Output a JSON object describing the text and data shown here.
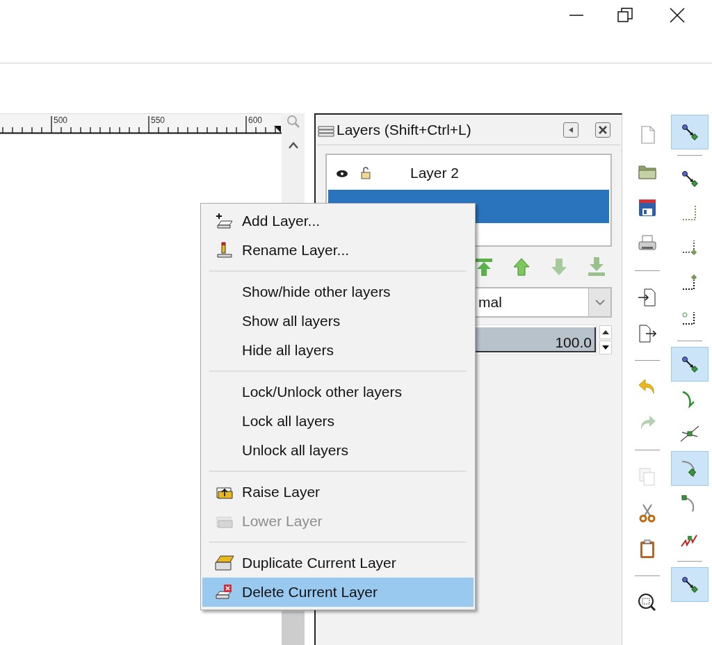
{
  "ruler": {
    "labels": [
      "500",
      "550",
      "600"
    ]
  },
  "layers_panel": {
    "title": "Layers (Shift+Ctrl+L)",
    "layers": [
      {
        "name": "Layer 2",
        "selected": false
      },
      {
        "selected": true
      }
    ],
    "blend_mode": {
      "value": "mal"
    },
    "opacity": {
      "value": "100.0",
      "level": 1
    }
  },
  "context_menu": [
    {
      "kind": "item",
      "label": "Add Layer...",
      "disabled": false,
      "selected": false
    },
    {
      "kind": "item",
      "label": "Rename Layer...",
      "disabled": false,
      "selected": false
    },
    {
      "kind": "separator"
    },
    {
      "kind": "item",
      "label": "Show/hide other layers",
      "disabled": false,
      "selected": false
    },
    {
      "kind": "item",
      "label": "Show all layers",
      "disabled": false,
      "selected": false
    },
    {
      "kind": "item",
      "label": "Hide all layers",
      "disabled": false,
      "selected": false
    },
    {
      "kind": "separator"
    },
    {
      "kind": "item",
      "label": "Lock/Unlock other layers",
      "disabled": false,
      "selected": false
    },
    {
      "kind": "item",
      "label": "Lock all layers",
      "disabled": false,
      "selected": false
    },
    {
      "kind": "item",
      "label": "Unlock all layers",
      "disabled": false,
      "selected": false
    },
    {
      "kind": "separator"
    },
    {
      "kind": "item",
      "label": "Raise Layer",
      "disabled": false,
      "selected": false
    },
    {
      "kind": "item",
      "label": "Lower Layer",
      "disabled": true,
      "selected": false
    },
    {
      "kind": "separator"
    },
    {
      "kind": "item",
      "label": "Duplicate Current Layer",
      "disabled": false,
      "selected": false
    },
    {
      "kind": "item",
      "label": "Delete Current Layer",
      "disabled": false,
      "selected": true
    }
  ],
  "commands_toolbar": [
    {
      "kind": "button",
      "disabled": false
    },
    {
      "kind": "button",
      "disabled": false
    },
    {
      "kind": "button",
      "disabled": false
    },
    {
      "kind": "button",
      "disabled": false
    },
    {
      "kind": "separator"
    },
    {
      "kind": "button",
      "disabled": false
    },
    {
      "kind": "button",
      "disabled": false
    },
    {
      "kind": "separator"
    },
    {
      "kind": "button",
      "disabled": false
    },
    {
      "kind": "button",
      "disabled": true
    },
    {
      "kind": "separator"
    },
    {
      "kind": "button",
      "disabled": true
    },
    {
      "kind": "button",
      "disabled": false
    },
    {
      "kind": "button",
      "disabled": false
    },
    {
      "kind": "separator"
    },
    {
      "kind": "button",
      "disabled": false
    }
  ],
  "snap_toolbar": [
    {
      "kind": "button",
      "on": true
    },
    {
      "kind": "separator"
    },
    {
      "kind": "button",
      "on": false
    },
    {
      "kind": "button",
      "on": false
    },
    {
      "kind": "button",
      "on": false
    },
    {
      "kind": "button",
      "on": false
    },
    {
      "kind": "button",
      "on": false
    },
    {
      "kind": "separator"
    },
    {
      "kind": "button",
      "on": true
    },
    {
      "kind": "button",
      "on": false
    },
    {
      "kind": "button",
      "on": false
    },
    {
      "kind": "button",
      "on": true
    },
    {
      "kind": "button",
      "on": false
    },
    {
      "kind": "button",
      "on": false
    },
    {
      "kind": "separator"
    },
    {
      "kind": "button",
      "on": true
    }
  ]
}
